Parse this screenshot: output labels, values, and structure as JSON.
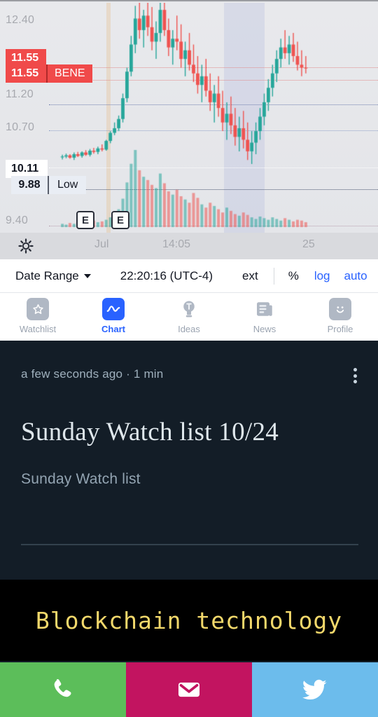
{
  "chart": {
    "symbol_tag": "BENE",
    "price_tag_top_1": "11.55",
    "price_tag_top_2": "11.55",
    "price_tag_mid": "10.11",
    "price_tag_low_value": "9.88",
    "price_tag_low_label": "Low",
    "y_axis_labels": [
      "12.40",
      "11.20",
      "10.70",
      "9.40"
    ],
    "x_axis_labels": [
      "Jul",
      "14:05",
      "25"
    ],
    "earnings_marker": "E",
    "gear_icon": "gear-icon",
    "colors": {
      "up": "#26a69a",
      "down": "#ef5350",
      "tag_red": "#f04a4a",
      "accent": "#2962ff",
      "background": "#e6e7ea"
    }
  },
  "toolbar": {
    "date_range_label": "Date Range",
    "chevron_icon": "chevron-down-icon",
    "time_label": "22:20:16 (UTC-4)",
    "ext_label": "ext",
    "percent_label": "%",
    "log_label": "log",
    "auto_label": "auto"
  },
  "bottom_nav": {
    "items": [
      {
        "label": "Watchlist",
        "icon": "star-icon",
        "active": false
      },
      {
        "label": "Chart",
        "icon": "chart-wave-icon",
        "active": true
      },
      {
        "label": "Ideas",
        "icon": "lightbulb-icon",
        "active": false
      },
      {
        "label": "News",
        "icon": "news-icon",
        "active": false
      },
      {
        "label": "Profile",
        "icon": "smiley-face-icon",
        "active": false
      }
    ]
  },
  "article": {
    "timestamp": "a few seconds ago",
    "separator": "·",
    "read_time": "1 min",
    "meta_line": "a few seconds ago  ·  1 min",
    "menu_icon": "kebab-menu-icon",
    "title": "Sunday Watch list 10/24",
    "subtitle": "Sunday Watch list"
  },
  "banner": {
    "text": "Blockchain technology",
    "text_color": "#f2d86b",
    "background_color": "#000000"
  },
  "share_bar": {
    "buttons": [
      {
        "name": "phone",
        "icon": "phone-icon",
        "color": "#5cbe5a"
      },
      {
        "name": "email",
        "icon": "envelope-icon",
        "color": "#c21460"
      },
      {
        "name": "twitter",
        "icon": "twitter-bird-icon",
        "color": "#6cbcec"
      }
    ]
  },
  "chart_data": {
    "type": "candlestick",
    "title": "BENE",
    "xlabel": "",
    "ylabel": "",
    "ylim": [
      9.2,
      12.6
    ],
    "y_ticks": [
      12.4,
      11.2,
      10.7,
      9.4
    ],
    "x_ticks": [
      "Jul",
      "14:05",
      "25"
    ],
    "last_price": 11.55,
    "low_price": 9.88,
    "mid_price": 10.11,
    "grid": true,
    "legend": "none",
    "candles": [
      {
        "x": 0.165,
        "o": 10.0,
        "h": 10.04,
        "l": 9.96,
        "c": 10.01,
        "dir": "up"
      },
      {
        "x": 0.175,
        "o": 10.01,
        "h": 10.06,
        "l": 9.98,
        "c": 10.03,
        "dir": "up"
      },
      {
        "x": 0.185,
        "o": 10.03,
        "h": 10.05,
        "l": 9.97,
        "c": 9.99,
        "dir": "down"
      },
      {
        "x": 0.196,
        "o": 9.99,
        "h": 10.08,
        "l": 9.95,
        "c": 10.05,
        "dir": "up"
      },
      {
        "x": 0.206,
        "o": 10.05,
        "h": 10.09,
        "l": 10.0,
        "c": 10.02,
        "dir": "down"
      },
      {
        "x": 0.217,
        "o": 10.02,
        "h": 10.1,
        "l": 9.99,
        "c": 10.08,
        "dir": "up"
      },
      {
        "x": 0.227,
        "o": 10.08,
        "h": 10.12,
        "l": 10.02,
        "c": 10.04,
        "dir": "down"
      },
      {
        "x": 0.238,
        "o": 10.04,
        "h": 10.14,
        "l": 10.01,
        "c": 10.11,
        "dir": "up"
      },
      {
        "x": 0.248,
        "o": 10.11,
        "h": 10.16,
        "l": 10.06,
        "c": 10.09,
        "dir": "down"
      },
      {
        "x": 0.259,
        "o": 10.09,
        "h": 10.18,
        "l": 10.05,
        "c": 10.15,
        "dir": "up"
      },
      {
        "x": 0.27,
        "o": 10.15,
        "h": 10.22,
        "l": 10.1,
        "c": 10.13,
        "dir": "down"
      },
      {
        "x": 0.281,
        "o": 10.13,
        "h": 10.3,
        "l": 10.11,
        "c": 10.28,
        "dir": "up"
      },
      {
        "x": 0.292,
        "o": 10.28,
        "h": 10.45,
        "l": 10.24,
        "c": 10.42,
        "dir": "up"
      },
      {
        "x": 0.303,
        "o": 10.42,
        "h": 10.6,
        "l": 10.38,
        "c": 10.5,
        "dir": "up"
      },
      {
        "x": 0.314,
        "o": 10.5,
        "h": 10.72,
        "l": 10.45,
        "c": 10.66,
        "dir": "up"
      },
      {
        "x": 0.325,
        "o": 10.66,
        "h": 11.1,
        "l": 10.6,
        "c": 11.02,
        "dir": "up"
      },
      {
        "x": 0.336,
        "o": 11.02,
        "h": 11.55,
        "l": 10.95,
        "c": 11.48,
        "dir": "up"
      },
      {
        "x": 0.347,
        "o": 11.48,
        "h": 12.1,
        "l": 11.4,
        "c": 11.95,
        "dir": "up"
      },
      {
        "x": 0.358,
        "o": 11.95,
        "h": 12.62,
        "l": 11.8,
        "c": 12.4,
        "dir": "up"
      },
      {
        "x": 0.369,
        "o": 12.4,
        "h": 12.7,
        "l": 12.05,
        "c": 12.2,
        "dir": "down"
      },
      {
        "x": 0.38,
        "o": 12.2,
        "h": 12.55,
        "l": 11.9,
        "c": 12.45,
        "dir": "up"
      },
      {
        "x": 0.391,
        "o": 12.45,
        "h": 12.8,
        "l": 12.1,
        "c": 12.25,
        "dir": "down"
      },
      {
        "x": 0.402,
        "o": 12.25,
        "h": 12.6,
        "l": 11.85,
        "c": 12.0,
        "dir": "down"
      },
      {
        "x": 0.413,
        "o": 12.0,
        "h": 12.35,
        "l": 11.7,
        "c": 12.15,
        "dir": "up"
      },
      {
        "x": 0.424,
        "o": 12.15,
        "h": 12.7,
        "l": 12.0,
        "c": 12.55,
        "dir": "up"
      },
      {
        "x": 0.435,
        "o": 12.55,
        "h": 12.75,
        "l": 12.1,
        "c": 12.2,
        "dir": "down"
      },
      {
        "x": 0.446,
        "o": 12.2,
        "h": 12.4,
        "l": 11.75,
        "c": 11.9,
        "dir": "down"
      },
      {
        "x": 0.457,
        "o": 11.9,
        "h": 12.2,
        "l": 11.6,
        "c": 12.05,
        "dir": "up"
      },
      {
        "x": 0.468,
        "o": 12.05,
        "h": 12.45,
        "l": 11.85,
        "c": 12.0,
        "dir": "down"
      },
      {
        "x": 0.479,
        "o": 12.0,
        "h": 12.3,
        "l": 11.55,
        "c": 11.7,
        "dir": "down"
      },
      {
        "x": 0.49,
        "o": 11.7,
        "h": 12.0,
        "l": 11.4,
        "c": 11.85,
        "dir": "up"
      },
      {
        "x": 0.501,
        "o": 11.85,
        "h": 12.15,
        "l": 11.5,
        "c": 11.6,
        "dir": "down"
      },
      {
        "x": 0.512,
        "o": 11.6,
        "h": 11.95,
        "l": 11.3,
        "c": 11.45,
        "dir": "down"
      },
      {
        "x": 0.523,
        "o": 11.45,
        "h": 11.75,
        "l": 11.1,
        "c": 11.25,
        "dir": "down"
      },
      {
        "x": 0.534,
        "o": 11.25,
        "h": 11.6,
        "l": 10.95,
        "c": 11.4,
        "dir": "up"
      },
      {
        "x": 0.545,
        "o": 11.4,
        "h": 11.7,
        "l": 11.05,
        "c": 11.15,
        "dir": "down"
      },
      {
        "x": 0.556,
        "o": 11.15,
        "h": 11.45,
        "l": 10.8,
        "c": 10.95,
        "dir": "down"
      },
      {
        "x": 0.567,
        "o": 10.95,
        "h": 11.25,
        "l": 10.6,
        "c": 11.1,
        "dir": "up"
      },
      {
        "x": 0.578,
        "o": 11.1,
        "h": 11.4,
        "l": 10.7,
        "c": 10.85,
        "dir": "down"
      },
      {
        "x": 0.589,
        "o": 10.85,
        "h": 11.15,
        "l": 10.45,
        "c": 10.6,
        "dir": "down"
      },
      {
        "x": 0.6,
        "o": 10.6,
        "h": 10.95,
        "l": 10.3,
        "c": 10.75,
        "dir": "up"
      },
      {
        "x": 0.611,
        "o": 10.75,
        "h": 11.05,
        "l": 10.4,
        "c": 10.55,
        "dir": "down"
      },
      {
        "x": 0.622,
        "o": 10.55,
        "h": 10.85,
        "l": 10.2,
        "c": 10.35,
        "dir": "down"
      },
      {
        "x": 0.633,
        "o": 10.35,
        "h": 10.7,
        "l": 10.1,
        "c": 10.5,
        "dir": "up"
      },
      {
        "x": 0.644,
        "o": 10.5,
        "h": 10.8,
        "l": 10.15,
        "c": 10.3,
        "dir": "down"
      },
      {
        "x": 0.655,
        "o": 10.3,
        "h": 10.6,
        "l": 9.95,
        "c": 10.1,
        "dir": "down"
      },
      {
        "x": 0.666,
        "o": 10.1,
        "h": 10.45,
        "l": 9.88,
        "c": 10.25,
        "dir": "up"
      },
      {
        "x": 0.677,
        "o": 10.25,
        "h": 10.6,
        "l": 10.05,
        "c": 10.45,
        "dir": "up"
      },
      {
        "x": 0.688,
        "o": 10.45,
        "h": 10.85,
        "l": 10.3,
        "c": 10.7,
        "dir": "up"
      },
      {
        "x": 0.699,
        "o": 10.7,
        "h": 11.1,
        "l": 10.55,
        "c": 10.95,
        "dir": "up"
      },
      {
        "x": 0.71,
        "o": 10.95,
        "h": 11.35,
        "l": 10.8,
        "c": 11.2,
        "dir": "up"
      },
      {
        "x": 0.721,
        "o": 11.2,
        "h": 11.6,
        "l": 11.05,
        "c": 11.45,
        "dir": "up"
      },
      {
        "x": 0.732,
        "o": 11.45,
        "h": 11.85,
        "l": 11.3,
        "c": 11.7,
        "dir": "up"
      },
      {
        "x": 0.743,
        "o": 11.7,
        "h": 12.05,
        "l": 11.55,
        "c": 11.9,
        "dir": "up"
      },
      {
        "x": 0.754,
        "o": 11.9,
        "h": 12.2,
        "l": 11.7,
        "c": 11.8,
        "dir": "down"
      },
      {
        "x": 0.765,
        "o": 11.8,
        "h": 12.1,
        "l": 11.6,
        "c": 11.95,
        "dir": "up"
      },
      {
        "x": 0.776,
        "o": 11.95,
        "h": 12.15,
        "l": 11.65,
        "c": 11.75,
        "dir": "down"
      },
      {
        "x": 0.787,
        "o": 11.75,
        "h": 12.0,
        "l": 11.5,
        "c": 11.6,
        "dir": "down"
      },
      {
        "x": 0.798,
        "o": 11.6,
        "h": 11.85,
        "l": 11.4,
        "c": 11.55,
        "dir": "down"
      },
      {
        "x": 0.809,
        "o": 11.55,
        "h": 11.75,
        "l": 11.45,
        "c": 11.55,
        "dir": "down"
      }
    ],
    "volume": [
      0.04,
      0.03,
      0.05,
      0.04,
      0.06,
      0.05,
      0.07,
      0.05,
      0.08,
      0.06,
      0.07,
      0.09,
      0.12,
      0.16,
      0.22,
      0.35,
      0.55,
      0.78,
      0.95,
      0.7,
      0.62,
      0.58,
      0.52,
      0.48,
      0.66,
      0.54,
      0.44,
      0.4,
      0.46,
      0.38,
      0.34,
      0.3,
      0.42,
      0.36,
      0.28,
      0.24,
      0.3,
      0.26,
      0.22,
      0.18,
      0.24,
      0.2,
      0.16,
      0.14,
      0.18,
      0.15,
      0.12,
      0.1,
      0.13,
      0.11,
      0.09,
      0.12,
      0.1,
      0.08,
      0.11,
      0.09,
      0.07,
      0.09,
      0.08,
      0.06
    ]
  }
}
